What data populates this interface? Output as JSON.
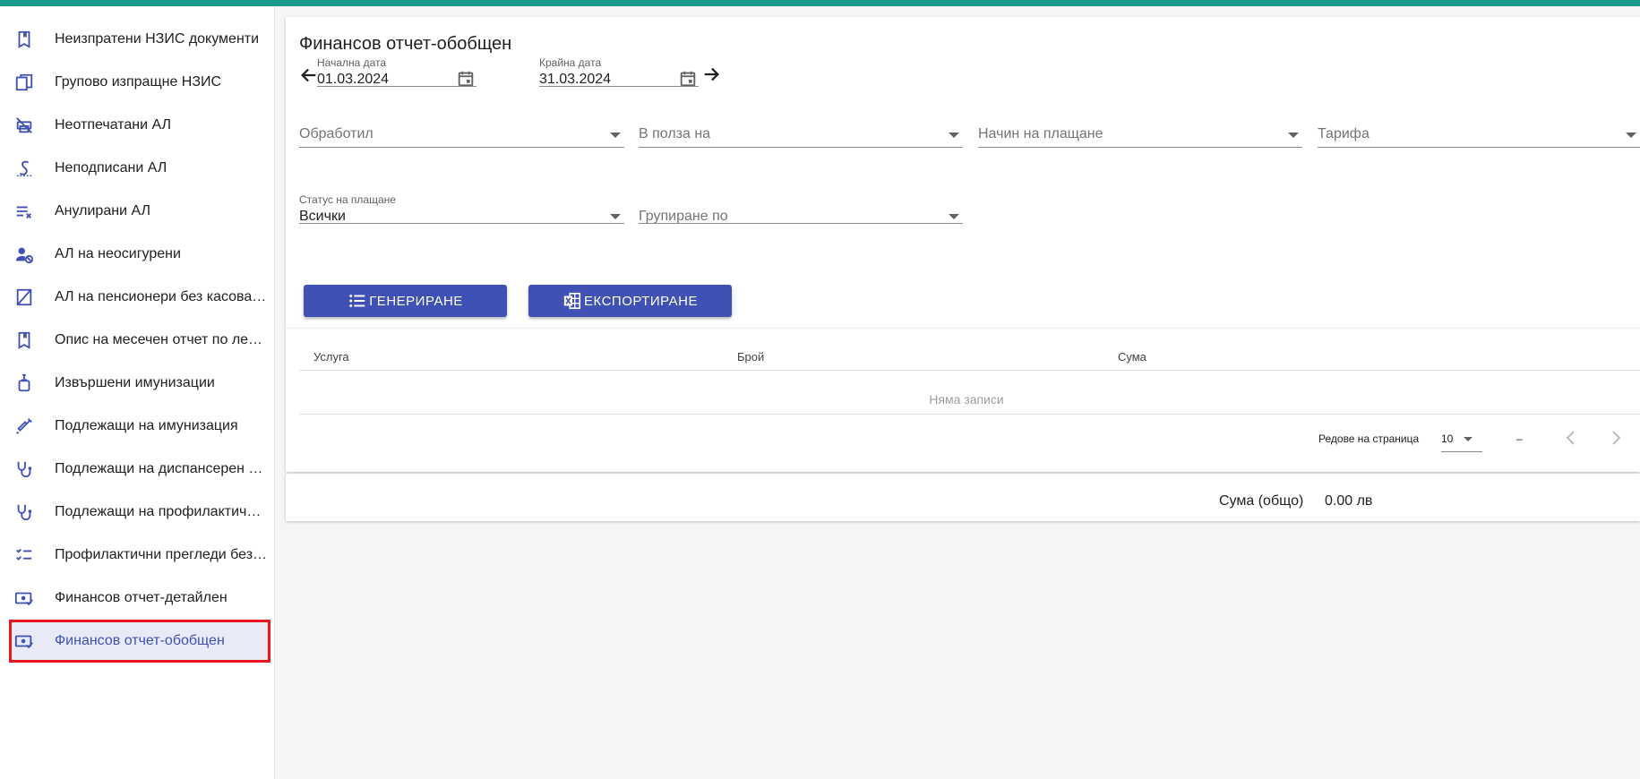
{
  "sidebar": {
    "items": [
      {
        "label": "Неизпратени НЗИС документи",
        "icon": "bookmark-icon"
      },
      {
        "label": "Групово изпращне НЗИС",
        "icon": "copy-documents-icon"
      },
      {
        "label": "Неотпечатани АЛ",
        "icon": "printer-off-icon"
      },
      {
        "label": "Неподписани АЛ",
        "icon": "signature-icon"
      },
      {
        "label": "Анулирани АЛ",
        "icon": "list-remove-icon"
      },
      {
        "label": "АЛ на неосигурени",
        "icon": "person-off-icon"
      },
      {
        "label": "АЛ на пенсионери без касова бележка",
        "icon": "note-slash-icon"
      },
      {
        "label": "Опис на месечен отчет по лекарствата",
        "icon": "bookmark-icon"
      },
      {
        "label": "Извършени имунизации",
        "icon": "vial-icon"
      },
      {
        "label": "Подлежащи на имунизация",
        "icon": "syringe-icon"
      },
      {
        "label": "Подлежащи на диспансерен преглед",
        "icon": "stethoscope-icon"
      },
      {
        "label": "Подлежащи на профилактичен преглед",
        "icon": "stethoscope-icon"
      },
      {
        "label": "Профилактични прегледи без резултат",
        "icon": "checklist-icon"
      },
      {
        "label": "Финансов отчет-детайлен",
        "icon": "cash-check-icon"
      },
      {
        "label": "Финансов отчет-обобщен",
        "icon": "cash-check-icon",
        "active": true
      }
    ]
  },
  "page": {
    "title": "Финансов отчет-обобщен"
  },
  "dates": {
    "start_label": "Начална дата",
    "start_value": "01.03.2024",
    "end_label": "Крайна дата",
    "end_value": "31.03.2024"
  },
  "filters": {
    "processed_by": "Обработил",
    "in_favor_of": "В полза на",
    "payment_method": "Начин на плащане",
    "tariff": "Тарифа",
    "payment_status_label": "Статус на плащане",
    "payment_status_value": "Всички",
    "group_by": "Групиране по"
  },
  "buttons": {
    "generate": "ГЕНЕРИРАНЕ",
    "export": "ЕКСПОРТИРАНЕ"
  },
  "table": {
    "columns": [
      "Услуга",
      "Брой",
      "Сума"
    ],
    "empty_text": "Няма записи"
  },
  "pagination": {
    "rows_per_page_label": "Редове на страница",
    "rows_per_page_value": "10",
    "range_text": "–"
  },
  "summary": {
    "label": "Сума (общо)",
    "value": "0.00 лв"
  },
  "colors": {
    "accent": "#3f51b5",
    "topbar": "#1a9a8c",
    "highlight_border": "#e8141c",
    "active_bg": "#e8eaf6"
  }
}
